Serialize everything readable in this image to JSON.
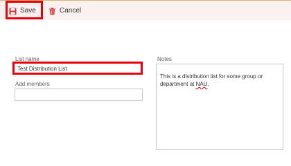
{
  "toolbar": {
    "save_label": "Save",
    "cancel_label": "Cancel",
    "save_icon": "floppy-disk-icon",
    "cancel_icon": "trash-icon",
    "accent": "#d13438",
    "highlight_color": "#e8000b"
  },
  "form": {
    "list_name_label": "List name",
    "list_name_value": "Test Distribution List",
    "add_members_label": "Add members",
    "add_members_value": "",
    "notes_label": "Notes",
    "notes_text_part1": "This is a distribution list for some group or department at ",
    "notes_text_word": "NAU",
    "notes_text_end": "."
  }
}
